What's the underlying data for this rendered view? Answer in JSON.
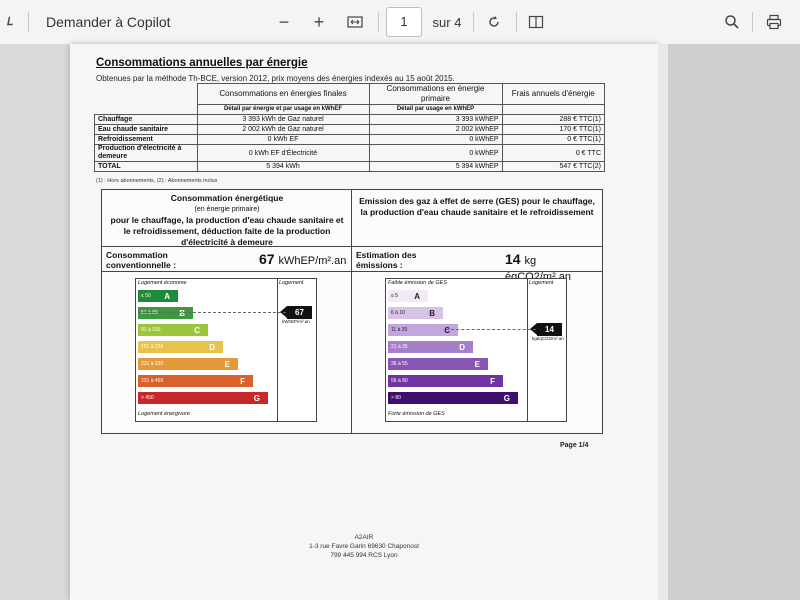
{
  "toolbar": {
    "copilot_label": "Demander à Copilot",
    "current_page": "1",
    "total_pages_label": "sur 4"
  },
  "doc": {
    "title": "Consommations annuelles par énergie",
    "subtitle": "Obtenues par la méthode Th-BCE, version 2012, prix moyens des énergies indexés au 15 août 2015.",
    "headers": [
      "Consommations en énergies finales",
      "Consommations en énergie primaire",
      "Frais annuels d'énergie"
    ],
    "detail_final": "Détail par énergie et par usage en kWhEF",
    "detail_primary": "Détail par usage en kWhEP",
    "rows": [
      {
        "label": "Chauffage",
        "final": "3 393 kWh de Gaz naturel",
        "primary": "3 393 kWhEP",
        "cost": "288 € TTC(1)"
      },
      {
        "label": "Eau chaude sanitaire",
        "final": "2 002 kWh de Gaz naturel",
        "primary": "2 002 kWhEP",
        "cost": "170 € TTC(1)"
      },
      {
        "label": "Refroidissement",
        "final": "0 kWh EF",
        "primary": "0 kWhEP",
        "cost": "0 € TTC(1)"
      },
      {
        "label": "Production d'électricité à demeure",
        "final": "0 kWh EF d'Électricité",
        "primary": "0 kWhEP",
        "cost": "0 € TTC"
      },
      {
        "label": "TOTAL",
        "final": "5 394 kWh",
        "primary": "5 394 kWhEP",
        "cost": "547 € TTC(2)"
      }
    ],
    "notes": "(1) : Hors abonnements, (2) : Abonnements inclus",
    "energy": {
      "title": "Consommation énergétique",
      "title_sub": "(en énergie primaire)",
      "title_desc": "pour le chauffage, la production d'eau chaude sanitaire et le refroidissement, déduction faite de la production d'électricité à demeure",
      "est_label": "Consommation conventionnelle :",
      "value": "67",
      "unit": "kWhEP/m².an",
      "top_label": "Logement économe",
      "bottom_label": "Logement énergivore",
      "logement_label": "Logement",
      "marker_value": "67",
      "marker_unit": "kWhEP/m².an",
      "marker_index": 1,
      "classes": [
        {
          "range": "≤ 50",
          "letter": "A",
          "color": "#1f8a3a"
        },
        {
          "range": "51 à 90",
          "letter": "B",
          "color": "#3c9a3e"
        },
        {
          "range": "91 à 150",
          "letter": "C",
          "color": "#9cc43c"
        },
        {
          "range": "151 à 230",
          "letter": "D",
          "color": "#e8c34a"
        },
        {
          "range": "231 à 330",
          "letter": "E",
          "color": "#e49a3a"
        },
        {
          "range": "331 à 450",
          "letter": "F",
          "color": "#d8612c"
        },
        {
          "range": "> 450",
          "letter": "G",
          "color": "#c8282a"
        }
      ]
    },
    "ges": {
      "title": "Emission des gaz à effet de serre (GES) pour le chauffage, la production d'eau chaude sanitaire et le refroidissement",
      "est_label": "Estimation des émissions :",
      "value": "14",
      "unit": "kg éqCO2/m².an",
      "top_label": "Faible émission de GES",
      "bottom_label": "Forte émission de GES",
      "logement_label": "Logement",
      "marker_value": "14",
      "marker_unit": "kgéqCO2/m².an",
      "marker_index": 2,
      "classes": [
        {
          "range": "≤ 5",
          "letter": "A",
          "color": "#f1e9f6"
        },
        {
          "range": "6 à 10",
          "letter": "B",
          "color": "#d6c3e6"
        },
        {
          "range": "11 à 20",
          "letter": "C",
          "color": "#c4a6dc"
        },
        {
          "range": "21 à 35",
          "letter": "D",
          "color": "#a77fc8"
        },
        {
          "range": "36 à 55",
          "letter": "E",
          "color": "#8a56b5"
        },
        {
          "range": "56 à 80",
          "letter": "F",
          "color": "#6f34a0"
        },
        {
          "range": "> 80",
          "letter": "G",
          "color": "#3f0f6e"
        }
      ]
    },
    "page_label": "Page 1/4",
    "footer": [
      "A2AIR",
      "1-3 rue Favre Garin 69630 Chaponost",
      "799 445 994 RCS Lyon"
    ]
  }
}
